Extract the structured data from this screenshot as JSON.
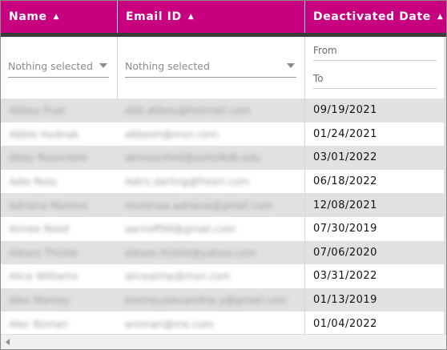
{
  "table": {
    "columns": [
      {
        "label": "Name",
        "sort_icon": "sort-asc-icon"
      },
      {
        "label": "Email ID",
        "sort_icon": "sort-asc-icon"
      },
      {
        "label": "Deactivated Date",
        "sort_icon": "sort-asc-icon"
      }
    ],
    "filters": {
      "name_select": "Nothing selected",
      "email_select": "Nothing selected",
      "date_from_placeholder": "From",
      "date_to_placeholder": "To"
    },
    "rows": [
      {
        "name": "Abbey Frye",
        "email": "abb.abbey@hotmail.com",
        "date": "09/19/2021"
      },
      {
        "name": "Abbie Hodnak",
        "email": "abbeeh@msn.com",
        "date": "01/24/2021"
      },
      {
        "name": "Abby Rosenfeld",
        "email": "abrosenfeld@outloRdb.edu",
        "date": "03/01/2022"
      },
      {
        "name": "Adie Ross",
        "email": "Adirs.darling@freeri.com",
        "date": "06/18/2022"
      },
      {
        "name": "Adriana Moreno",
        "email": "morenoa.adriana@gmail.com",
        "date": "12/08/2021"
      },
      {
        "name": "Aimee Reed",
        "email": "aanreff99@gmail.com",
        "date": "07/30/2019"
      },
      {
        "name": "Alexes Thistle",
        "email": "alexes.thistle@yahoo.com",
        "date": "07/06/2020"
      },
      {
        "name": "Alice Williams",
        "email": "aliceatmp@msn.com",
        "date": "03/31/2022"
      },
      {
        "name": "Alex Mamey",
        "email": "bremeyalexandria.y@gmail.com",
        "date": "01/13/2019"
      },
      {
        "name": "Alec Roman",
        "email": "aroman@me.com",
        "date": "01/04/2022"
      }
    ]
  },
  "colors": {
    "header_bg": "#c8007f",
    "stripe": "#e1e1e1",
    "divider": "#3a3a3a"
  }
}
